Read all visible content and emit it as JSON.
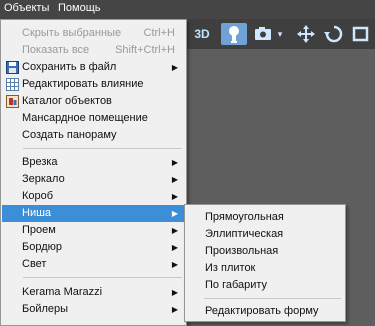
{
  "menubar": {
    "items": [
      {
        "label": "Объекты"
      },
      {
        "label": "Помощь"
      }
    ]
  },
  "toolbar": {
    "view3d_label": "3D"
  },
  "menu": {
    "hide_selected": {
      "label": "Скрыть выбранные",
      "shortcut": "Ctrl+H"
    },
    "show_all": {
      "label": "Показать все",
      "shortcut": "Shift+Ctrl+H"
    },
    "save_to_file": {
      "label": "Сохранить в файл"
    },
    "edit_influence": {
      "label": "Редактировать влияние"
    },
    "object_catalog": {
      "label": "Каталог объектов"
    },
    "attic_room": {
      "label": "Мансардное помещение"
    },
    "create_panorama": {
      "label": "Создать панораму"
    },
    "insert": {
      "label": "Врезка"
    },
    "mirror": {
      "label": "Зеркало"
    },
    "box": {
      "label": "Короб"
    },
    "niche": {
      "label": "Ниша"
    },
    "opening": {
      "label": "Проем"
    },
    "border": {
      "label": "Бордюр"
    },
    "light": {
      "label": "Свет"
    },
    "kerama": {
      "label": "Kerama Marazzi"
    },
    "boilers": {
      "label": "Бойлеры"
    }
  },
  "submenu": {
    "rectangular": "Прямоугольная",
    "elliptical": "Эллиптическая",
    "arbitrary": "Произвольная",
    "from_tiles": "Из плиток",
    "by_dimensions": "По габариту",
    "edit_shape": "Редактировать форму"
  }
}
